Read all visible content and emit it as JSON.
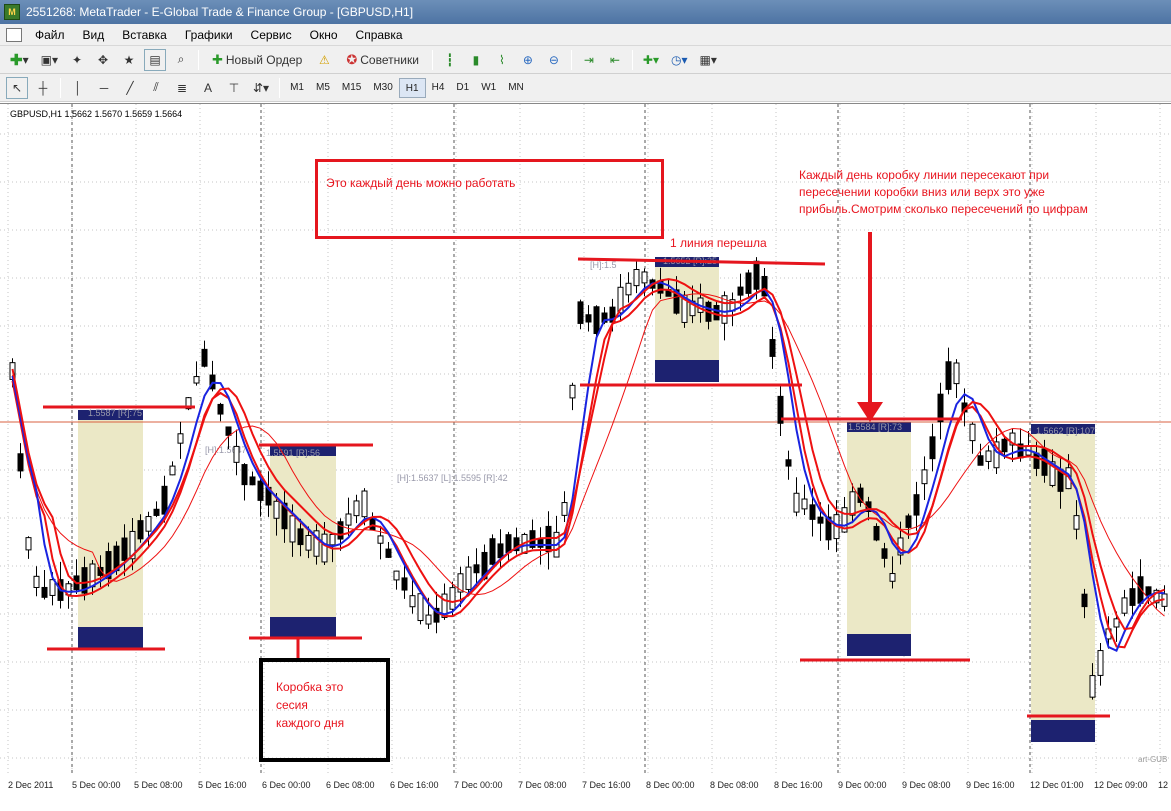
{
  "window": {
    "title": "2551268: MetaTrader - E-Global Trade & Finance Group - [GBPUSD,H1]",
    "app_icon": "metatrader-icon"
  },
  "menu": [
    "Файл",
    "Вид",
    "Вставка",
    "Графики",
    "Сервис",
    "Окно",
    "Справка"
  ],
  "toolbar": {
    "new_order": "Новый Ордер",
    "experts": "Советники"
  },
  "timeframes": [
    "M1",
    "M5",
    "M15",
    "M30",
    "H1",
    "H4",
    "D1",
    "W1",
    "MN"
  ],
  "active_timeframe": "H1",
  "chart_info": "GBPUSD,H1  1.5662 1.5670 1.5659 1.5664",
  "colors": {
    "session_box": "#ebe8c6",
    "session_bottom": "#1d2270",
    "ma_red": "#ee1111",
    "ma_blue": "#1a24e0",
    "annotation": "#e5161e",
    "bid_line": "#d86040"
  },
  "annotations": {
    "box_text": "Это каждый день можно работать",
    "right_text": "Каждый день коробку линии пересекают при пересечении коробки вниз или верх это уже прибыль.Смотрим сколько пересечений по цифрам",
    "line_text": "1 линия перешла",
    "session_text": "Коробка это\nсесия\nкаждого дня"
  },
  "box_labels": [
    {
      "text": "1.5587 [R]:75"
    },
    {
      "text": "[H]:1.5647"
    },
    {
      "text": "1.5591 [R]:56"
    },
    {
      "text": "[H]:1.5637 [L]:1.5595 [R]:42"
    },
    {
      "text": "[H]:1.5"
    },
    {
      "text": "1.5652 [R]:25"
    },
    {
      "text": "1.5584 [R]:73"
    },
    {
      "text": "1.5662 [R]:107"
    }
  ],
  "x_labels": [
    "2 Dec 2011",
    "5 Dec 00:00",
    "5 Dec 08:00",
    "5 Dec 16:00",
    "6 Dec 00:00",
    "6 Dec 08:00",
    "6 Dec 16:00",
    "7 Dec 00:00",
    "7 Dec 08:00",
    "7 Dec 16:00",
    "8 Dec 00:00",
    "8 Dec 08:00",
    "8 Dec 16:00",
    "9 Dec 00:00",
    "9 Dec 08:00",
    "9 Dec 16:00",
    "12 Dec 01:00",
    "12 Dec 09:00",
    "12"
  ],
  "watermark": "art-GUB",
  "chart_data": {
    "type": "candlestick",
    "symbol": "GBPUSD",
    "timeframe": "H1",
    "last_quote": {
      "open": 1.5662,
      "high": 1.567,
      "low": 1.5659,
      "close": 1.5664
    }
  }
}
